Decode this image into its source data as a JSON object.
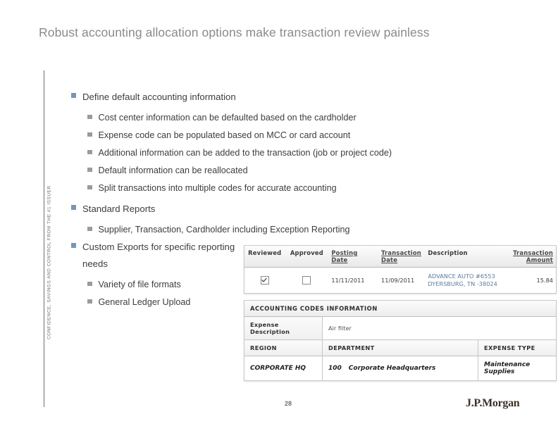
{
  "slide": {
    "title": "Robust accounting allocation options make transaction review painless",
    "side_caption": "CONFIDENCE, SAVINGS AND CONTROL FROM THE #1 ISSUER",
    "page_number": "28",
    "logo_text": "J.P.Morgan",
    "accent_color_level1_bullet": "#7396bf",
    "accent_color_level2_bullet": "#9b9b9b",
    "title_color": "#8a8a8a"
  },
  "content": {
    "group1": {
      "heading": "Define default accounting information",
      "items": [
        "Cost center information can be defaulted based on the cardholder",
        "Expense code can be populated based on MCC or card account",
        "Additional information can be added  to the transaction (job or project  code)",
        "Default information can be reallocated",
        "Split transactions into multiple codes for accurate accounting"
      ]
    },
    "group2": {
      "heading": "Standard Reports",
      "items": [
        "Supplier, Transaction, Cardholder including Exception Reporting"
      ]
    },
    "group3": {
      "heading": "Custom Exports for specific reporting needs",
      "items": [
        "Variety of file formats",
        "General Ledger Upload"
      ]
    }
  },
  "screenshot": {
    "transaction_table": {
      "headers": {
        "reviewed": "Reviewed",
        "approved": "Approved",
        "posting_date": "Posting Date",
        "transaction_date": "Transaction Date",
        "description": "Description",
        "transaction_amount": "Transaction Amount"
      },
      "rows": [
        {
          "reviewed_checked": true,
          "approved_checked": false,
          "posting_date": "11/11/2011",
          "transaction_date": "11/09/2011",
          "description_line1": "ADVANCE AUTO #6553",
          "description_line2": "DYERSBURG, TN -38024",
          "amount": "15.84"
        }
      ]
    },
    "accounting_codes": {
      "panel_title": "ACCOUNTING CODES INFORMATION",
      "expense_description_label": "Expense Description",
      "expense_description_value": "Air filter",
      "column_headers": {
        "region": "REGION",
        "department": "DEPARTMENT",
        "expense_type": "EXPENSE TYPE"
      },
      "values": {
        "region": "CORPORATE HQ",
        "department_number": "100",
        "department_name": "Corporate Headquarters",
        "expense_type": "Maintenance Supplies"
      }
    }
  }
}
